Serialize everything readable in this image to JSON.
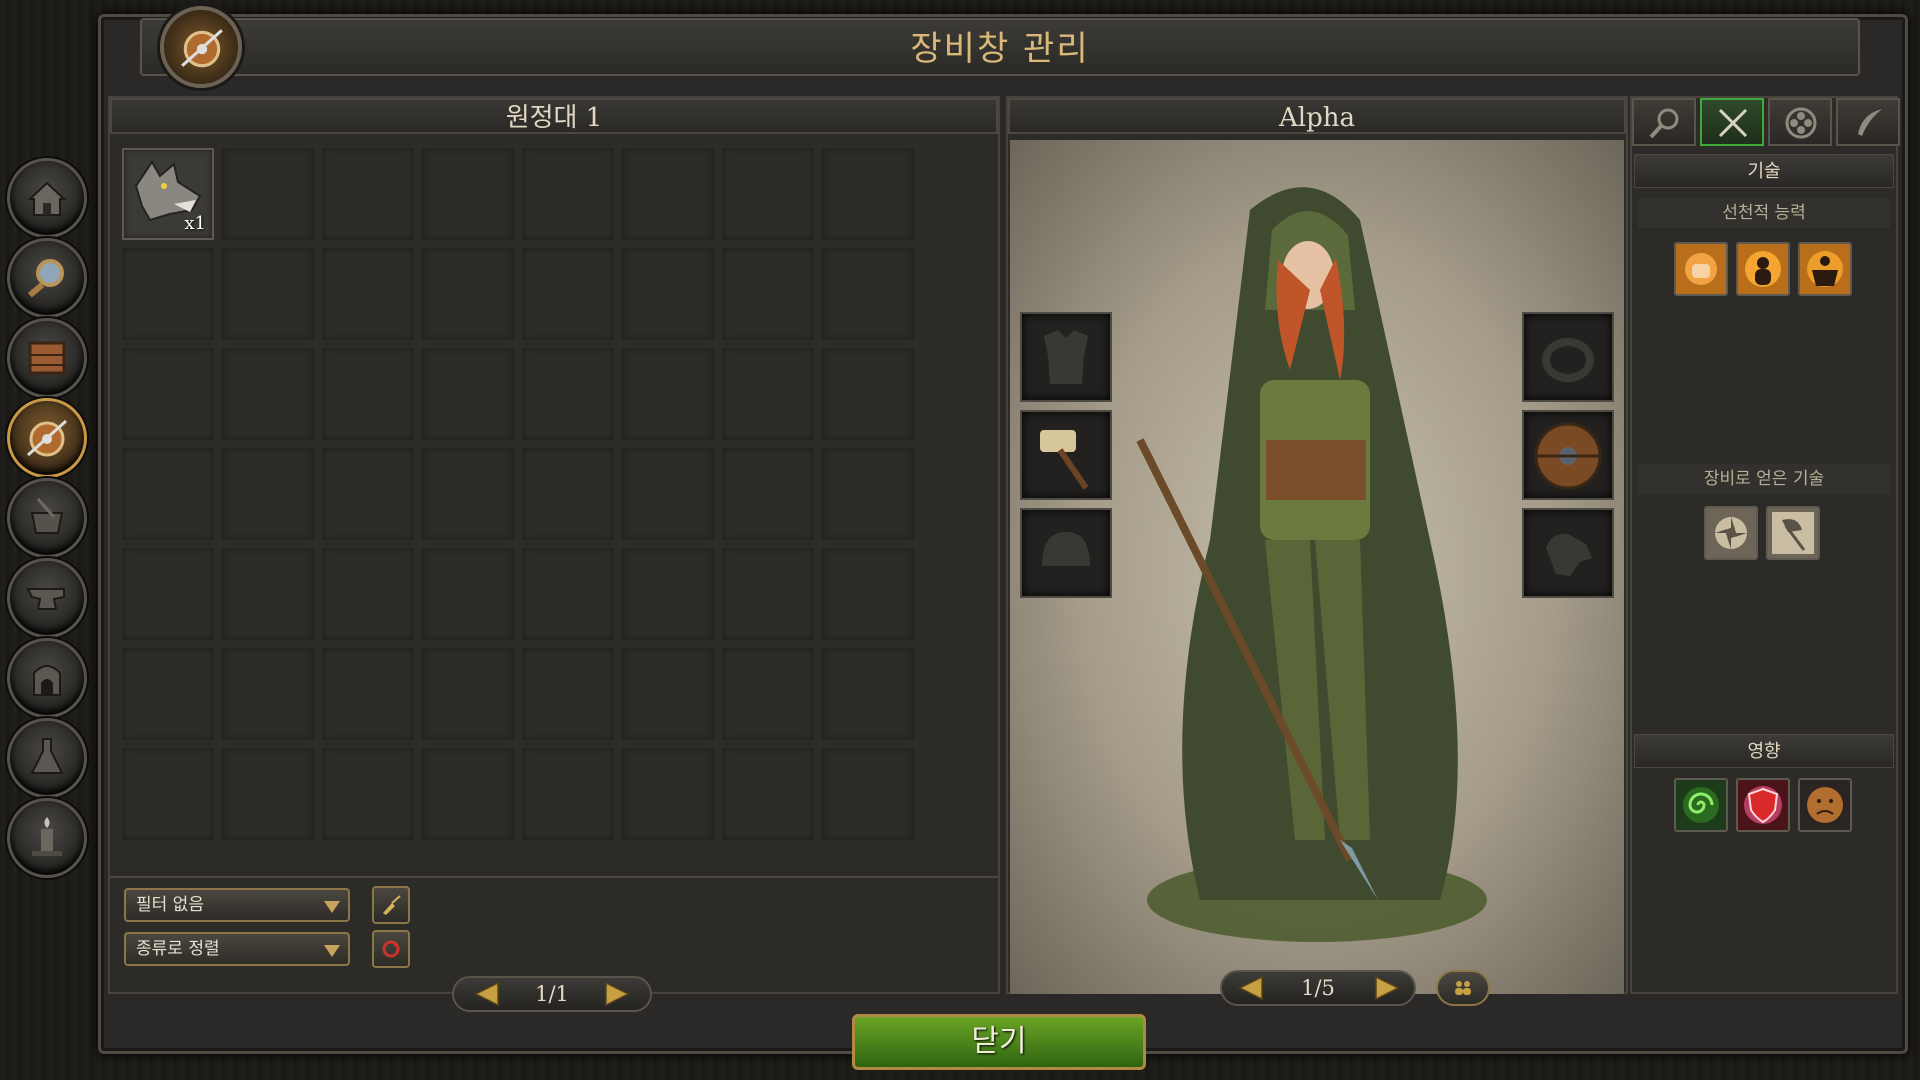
{
  "window": {
    "title": "장비창 관리"
  },
  "sidebar": {
    "items": [
      {
        "icon": "house-icon"
      },
      {
        "icon": "magnifier-icon"
      },
      {
        "icon": "crate-icon"
      },
      {
        "icon": "shield-spear-icon",
        "active": true
      },
      {
        "icon": "cauldron-icon"
      },
      {
        "icon": "anvil-icon"
      },
      {
        "icon": "furnace-icon"
      },
      {
        "icon": "flask-icon"
      },
      {
        "icon": "candle-icon"
      }
    ]
  },
  "inventory": {
    "header": "원정대 1",
    "items": [
      {
        "icon": "wolf-icon",
        "quantity": "x1"
      }
    ],
    "filter": {
      "selected": "필터 없음"
    },
    "sort": {
      "selected": "종류로 정렬"
    },
    "pager": {
      "text": "1/1"
    }
  },
  "character": {
    "name": "Alpha",
    "pager": {
      "text": "1/5"
    },
    "equipment_left": [
      "armor-slot-icon",
      "hammer-icon",
      "helmet-slot-icon"
    ],
    "equipment_right": [
      "ring-slot-icon",
      "round-shield-icon",
      "pet-slot-icon"
    ]
  },
  "skills_panel": {
    "tabs": [
      "search-tab-icon",
      "crossed-swords-icon",
      "clover-tab-icon",
      "feather-tab-icon"
    ],
    "active_tab": 1,
    "header": "기술",
    "innate_header": "선천적 능력",
    "innate_icons": [
      "fist-skill-icon",
      "aura-skill-icon",
      "strength-skill-icon"
    ],
    "equipment_skills_header": "장비로 얻은 기술",
    "equipment_skill_icons": [
      "whirl-skill-icon",
      "axe-skill-icon"
    ],
    "effects_header": "영향",
    "effect_icons": [
      "green-spiral-icon",
      "red-shield-icon",
      "sad-face-icon"
    ]
  },
  "footer": {
    "close_label": "닫기"
  },
  "colors": {
    "accent_gold": "#d9b878",
    "active_green": "#3ea83a",
    "close_green": "#4f8a1c"
  }
}
